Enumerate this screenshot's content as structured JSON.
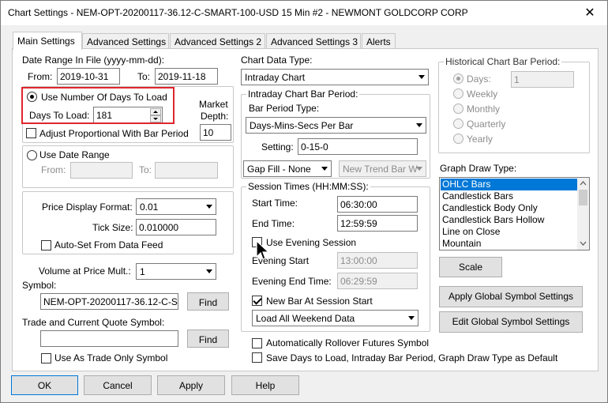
{
  "window": {
    "title": "Chart Settings - NEM-OPT-20200117-36.12-C-SMART-100-USD  15 Min  #2 - NEWMONT GOLDCORP CORP",
    "close_glyph": "✕"
  },
  "tabs": [
    {
      "label": "Main Settings"
    },
    {
      "label": "Advanced Settings"
    },
    {
      "label": "Advanced Settings 2"
    },
    {
      "label": "Advanced Settings 3"
    },
    {
      "label": "Alerts"
    }
  ],
  "date_range": {
    "label": "Date Range In File (yyyy-mm-dd):",
    "from_label": "From:",
    "from_value": "2019-10-31",
    "to_label": "To:",
    "to_value": "2019-11-18"
  },
  "days_to_load": {
    "radio_label": "Use Number Of Days To Load",
    "days_label": "Days To Load:",
    "days_value": "181",
    "market_depth_label_1": "Market",
    "market_depth_label_2": "Depth:",
    "market_depth_value": "10",
    "adjust_label": "Adjust Proportional With Bar Period"
  },
  "use_date_range": {
    "radio_label": "Use Date Range",
    "from_label": "From:",
    "to_label": "To:"
  },
  "price": {
    "format_label": "Price Display Format:",
    "format_value": "0.01",
    "tick_label": "Tick Size:",
    "tick_value": "0.010000",
    "auto_set_label": "Auto-Set From Data Feed"
  },
  "volume": {
    "label": "Volume at Price Mult.:",
    "value": "1"
  },
  "symbol": {
    "label": "Symbol:",
    "value": "NEM-OPT-20200117-36.12-C-S",
    "find_label": "Find"
  },
  "trade_symbol": {
    "label": "Trade and Current Quote Symbol:",
    "value": "",
    "find_label": "Find",
    "trade_only_label": "Use As Trade Only Symbol"
  },
  "chart_data_type": {
    "label": "Chart Data Type:",
    "value": "Intraday Chart"
  },
  "intraday": {
    "group_label": "Intraday Chart Bar Period:",
    "bar_period_type_label": "Bar Period Type:",
    "bar_period_type_value": "Days-Mins-Secs Per Bar",
    "setting_label": "Setting:",
    "setting_value": "0-15-0",
    "gap_fill_value": "Gap Fill - None",
    "new_trend_value": "New Trend Bar W"
  },
  "session": {
    "group_label": "Session Times (HH:MM:SS):",
    "start_label": "Start Time:",
    "start_value": "06:30:00",
    "end_label": "End Time:",
    "end_value": "12:59:59",
    "evening_session_label": "Use Evening Session",
    "evening_start_label": "Evening Start",
    "evening_start_value": "13:00:00",
    "evening_end_label": "Evening End Time:",
    "evening_end_value": "06:29:59",
    "new_bar_label": "New Bar At Session Start",
    "weekend_value": "Load All Weekend Data"
  },
  "bottom_checks": {
    "rollover_label": "Automatically Rollover Futures Symbol",
    "save_days_label": "Save Days to Load, Intraday Bar Period, Graph Draw Type as Default"
  },
  "historical": {
    "group_label": "Historical Chart Bar Period:",
    "days_label": "Days:",
    "days_value": "1",
    "weekly_label": "Weekly",
    "monthly_label": "Monthly",
    "quarterly_label": "Quarterly",
    "yearly_label": "Yearly"
  },
  "graph_draw": {
    "label": "Graph Draw Type:",
    "items": [
      "OHLC Bars",
      "Candlestick Bars",
      "Candlestick Body Only",
      "Candlestick Bars Hollow",
      "Line on Close",
      "Mountain"
    ],
    "selected": "OHLC Bars"
  },
  "buttons": {
    "scale": "Scale",
    "apply_global": "Apply Global Symbol Settings",
    "edit_global": "Edit Global Symbol Settings",
    "ok": "OK",
    "cancel": "Cancel",
    "apply": "Apply",
    "help": "Help"
  },
  "colors": {
    "selection": "#0078d7",
    "highlight_box": "#e0262d"
  }
}
